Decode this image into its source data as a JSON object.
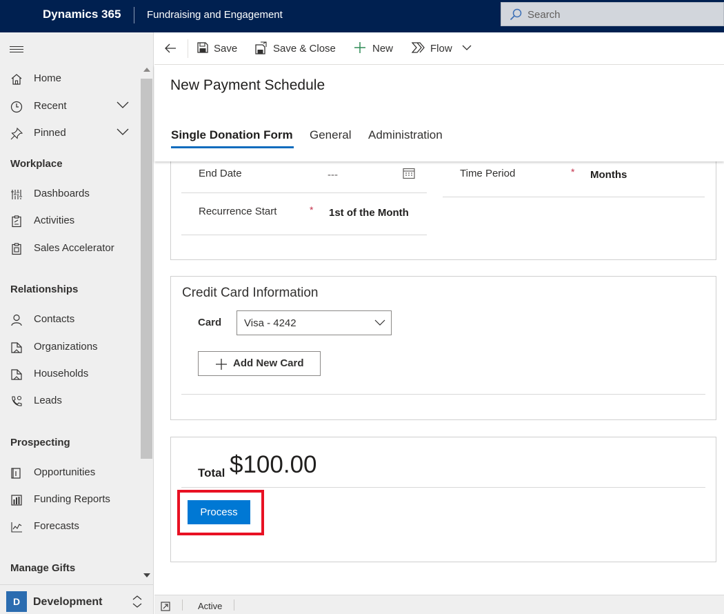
{
  "topbar": {
    "brand": "Dynamics 365",
    "app_name": "Fundraising and Engagement",
    "search_placeholder": "Search",
    "bg_color": "#002050"
  },
  "sidebar": {
    "items_top": [
      {
        "label": "Home",
        "icon": "home-icon"
      },
      {
        "label": "Recent",
        "icon": "clock-icon",
        "expandable": true
      },
      {
        "label": "Pinned",
        "icon": "pin-icon",
        "expandable": true
      }
    ],
    "groups": [
      {
        "title": "Workplace",
        "items": [
          {
            "label": "Dashboards",
            "icon": "dashboard-icon"
          },
          {
            "label": "Activities",
            "icon": "clipboard-icon"
          },
          {
            "label": "Sales Accelerator",
            "icon": "clipboard-check-icon"
          }
        ]
      },
      {
        "title": "Relationships",
        "items": [
          {
            "label": "Contacts",
            "icon": "person-icon"
          },
          {
            "label": "Organizations",
            "icon": "building-icon"
          },
          {
            "label": "Households",
            "icon": "building-icon"
          },
          {
            "label": "Leads",
            "icon": "phone-person-icon"
          }
        ]
      },
      {
        "title": "Prospecting",
        "items": [
          {
            "label": "Opportunities",
            "icon": "opportunity-icon"
          },
          {
            "label": "Funding Reports",
            "icon": "bar-chart-icon"
          },
          {
            "label": "Forecasts",
            "icon": "line-chart-icon"
          }
        ]
      },
      {
        "title": "Manage Gifts",
        "items": []
      }
    ],
    "area": {
      "badge": "D",
      "label": "Development",
      "badge_color": "#2b6cb0"
    }
  },
  "commandbar": {
    "back_label": "",
    "save": "Save",
    "save_close": "Save & Close",
    "new": "New",
    "flow": "Flow"
  },
  "form": {
    "title": "New Payment Schedule",
    "tabs": [
      "Single Donation Form",
      "General",
      "Administration"
    ],
    "active_tab": "Single Donation Form"
  },
  "schedule": {
    "end_date_label": "End Date",
    "end_date_value": "---",
    "time_period_label": "Time Period",
    "time_period_value": "Months",
    "recurrence_start_label": "Recurrence Start",
    "recurrence_start_value": "1st of the Month",
    "required_marker": "*"
  },
  "credit_card": {
    "section_title": "Credit Card Information",
    "card_label": "Card",
    "card_value": "Visa - 4242",
    "add_new_card": "Add New Card"
  },
  "total": {
    "label": "Total",
    "value": "$100.00",
    "process_button": "Process",
    "highlight_color": "#e81123"
  },
  "status": {
    "text": "Active"
  }
}
